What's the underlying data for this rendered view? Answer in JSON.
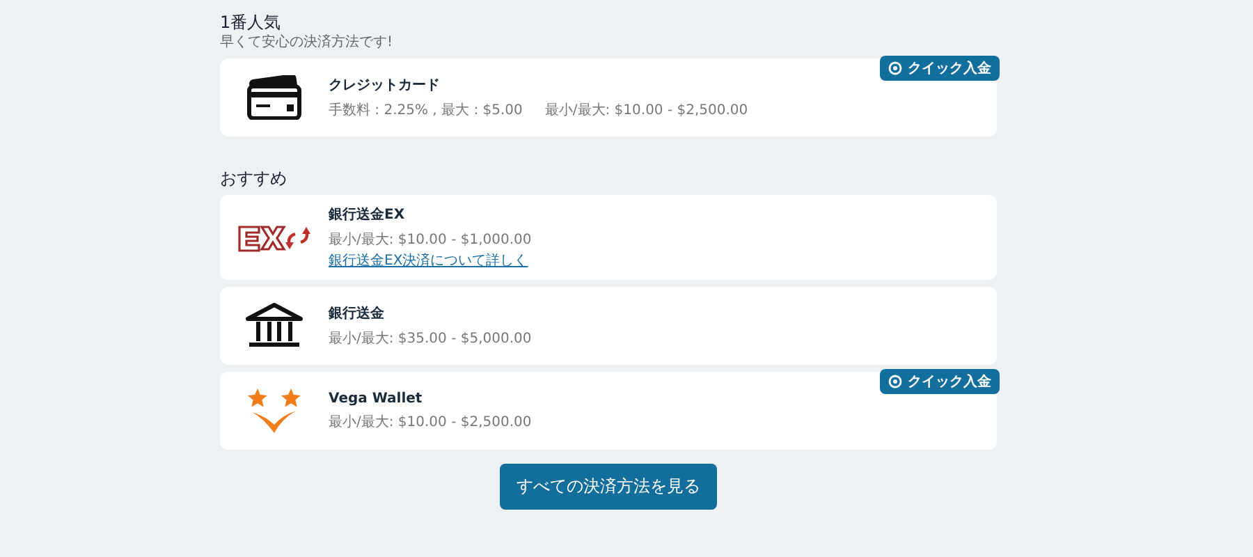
{
  "sections": [
    {
      "title": "1番人気",
      "subtitle": "早くて安心の決済方法です!",
      "methods": [
        {
          "kind": "card",
          "name": "クレジットカード",
          "details": [
            "手数料 : 2.25% , 最大 : $5.00",
            "最小/最大: $10.00 - $2,500.00"
          ],
          "quick": "クイック入金"
        }
      ]
    },
    {
      "title": "おすすめ",
      "methods": [
        {
          "kind": "ex",
          "name": "銀行送金EX",
          "details": [
            "最小/最大: $10.00 - $1,000.00"
          ],
          "link": "銀行送金EX決済について詳しく"
        },
        {
          "kind": "bank",
          "name": "銀行送金",
          "details": [
            "最小/最大: $35.00 - $5,000.00"
          ]
        },
        {
          "kind": "wallet",
          "name": "Vega Wallet",
          "details": [
            "最小/最大: $10.00 - $2,500.00"
          ],
          "quick": "クイック入金"
        }
      ]
    }
  ],
  "all_button": "すべての決済方法を見る"
}
